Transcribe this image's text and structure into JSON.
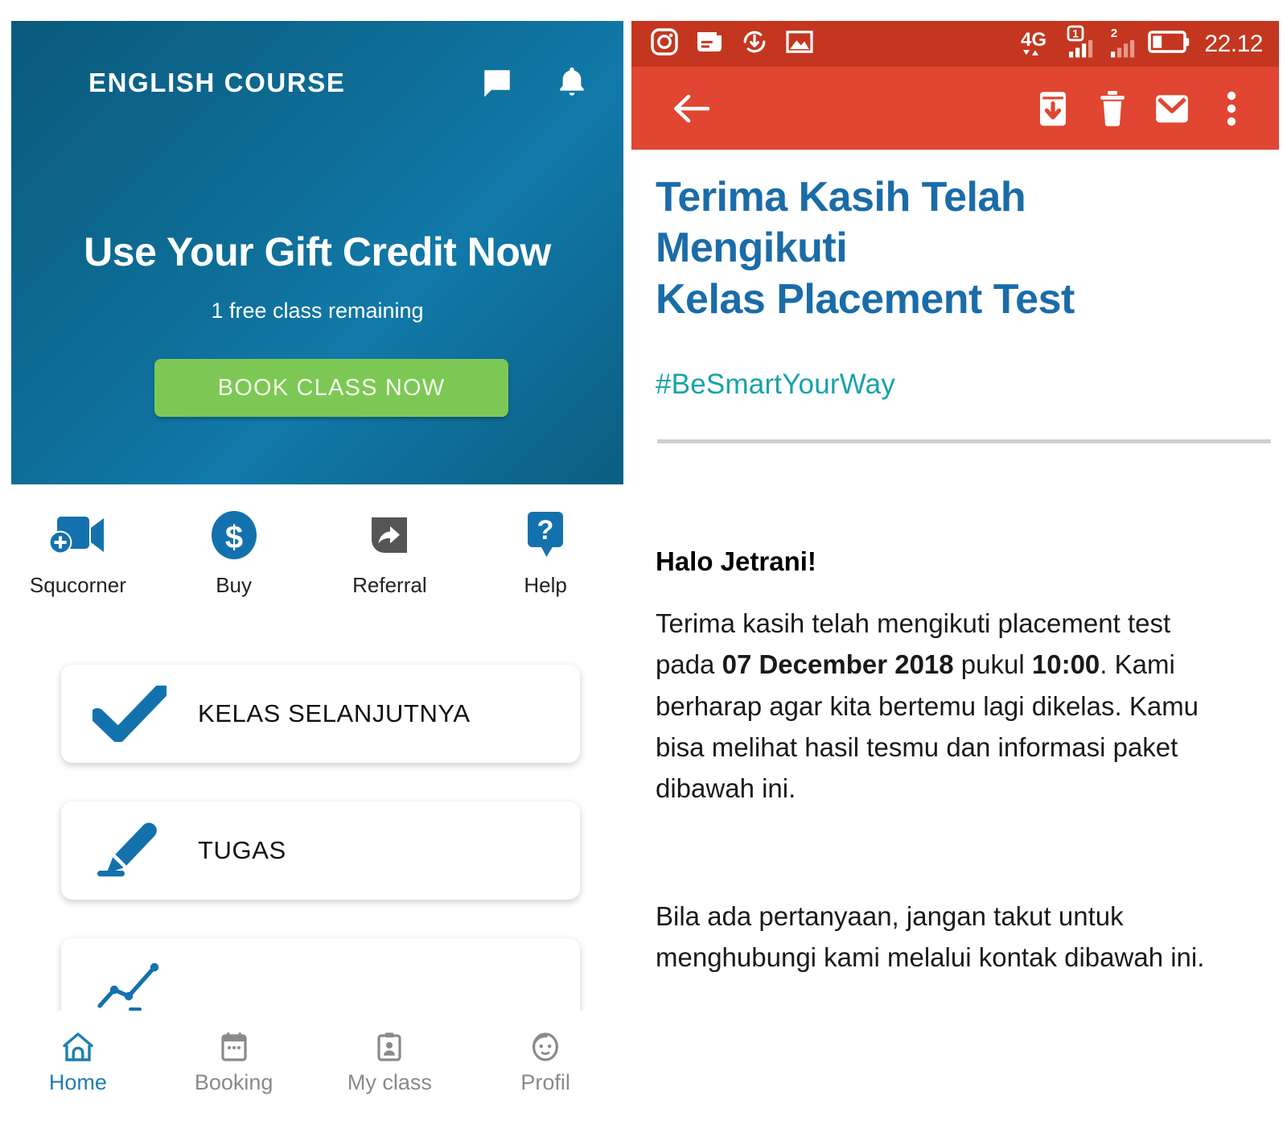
{
  "app": {
    "header": {
      "title": "ENGLISH COURSE",
      "chat_icon": "chat-bubble-icon",
      "bell_icon": "notification-bell-icon"
    },
    "hero": {
      "headline": "Use Your Gift Credit Now",
      "subtext": "1 free class remaining",
      "cta_label": "BOOK CLASS NOW",
      "gradient_from": "#0a5a7c",
      "gradient_to": "#0b5e81",
      "cta_color": "#7dc855"
    },
    "quick_actions": [
      {
        "label": "Squcorner",
        "icon": "video-camera-plus-icon",
        "color": "#1372ad"
      },
      {
        "label": "Buy",
        "icon": "dollar-circle-icon",
        "color": "#1372ad"
      },
      {
        "label": "Referral",
        "icon": "share-arrow-icon",
        "color": "#555555"
      },
      {
        "label": "Help",
        "icon": "question-mark-bubble-icon",
        "color": "#1372ad"
      }
    ],
    "menu_cards": [
      {
        "label": "KELAS SELANJUTNYA",
        "icon": "checkmark-icon"
      },
      {
        "label": "TUGAS",
        "icon": "pen-marker-icon"
      },
      {
        "label": "",
        "icon": "line-chart-icon"
      }
    ],
    "bottom_nav": [
      {
        "label": "Home",
        "icon": "home-icon",
        "active": true
      },
      {
        "label": "Booking",
        "icon": "calendar-icon",
        "active": false
      },
      {
        "label": "My class",
        "icon": "id-card-icon",
        "active": false
      },
      {
        "label": "Profil",
        "icon": "face-avatar-icon",
        "active": false
      }
    ],
    "accent_color": "#1d7fb0"
  },
  "mail": {
    "statusbar": {
      "time": "22.12",
      "network": "4G",
      "sim1_label": "1",
      "sim2_label": "2",
      "left_icons": [
        "instagram-icon",
        "news-article-icon",
        "sync-download-icon",
        "image-icon"
      ],
      "right_icons": [
        "network-4g-icon",
        "signal-sim1-icon",
        "signal-sim2-icon",
        "battery-icon"
      ],
      "background": "#c4361f"
    },
    "toolbar": {
      "background": "#e04631",
      "back_icon": "back-arrow-icon",
      "actions": [
        "archive-icon",
        "delete-trash-icon",
        "mark-unread-envelope-icon",
        "overflow-menu-icon"
      ]
    },
    "content": {
      "subject_line1": "Terima Kasih Telah",
      "subject_line2": "Mengikuti",
      "subject_line3": "Kelas Placement Test",
      "subject_color": "#1a6ca8",
      "hashtag": "#BeSmartYourWay",
      "hashtag_color": "#17a3ab",
      "greeting": "Halo Jetrani!",
      "paragraph1_a": "Terima kasih telah mengikuti placement test pada ",
      "paragraph1_date": "07 December 2018",
      "paragraph1_b": " pukul ",
      "paragraph1_time": "10:00",
      "paragraph1_c": ". Kami berharap agar kita bertemu lagi dikelas. Kamu bisa melihat hasil tesmu dan informasi paket dibawah ini.",
      "paragraph2": "Bila ada pertanyaan, jangan takut untuk menghubungi kami melalui kontak dibawah ini."
    }
  }
}
